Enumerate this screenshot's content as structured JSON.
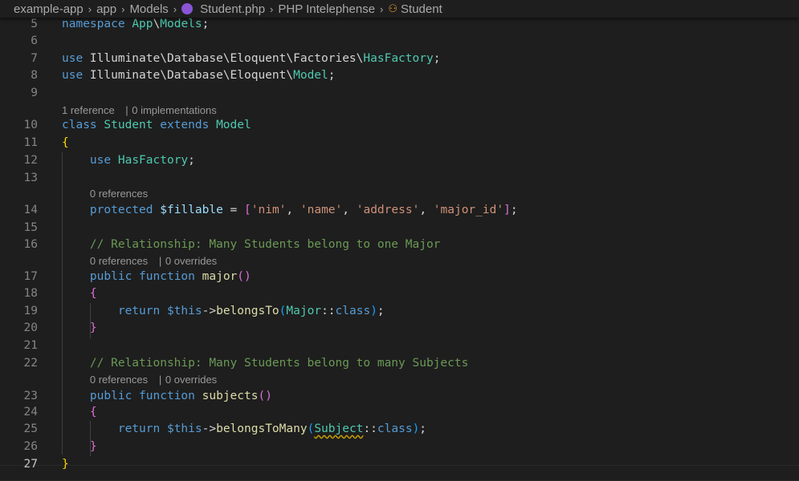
{
  "breadcrumb": {
    "items": [
      "example-app",
      "app",
      "Models",
      "Student.php",
      "PHP Intelephense",
      "Student"
    ],
    "separator": "›",
    "file_icon": "php-elephant-icon",
    "symbol_icon": "class-symbol-icon"
  },
  "colors": {
    "background": "#1e1e1e",
    "keyword": "#569cd6",
    "class_name": "#4ec9b0",
    "function": "#dcdcaa",
    "string": "#ce9178",
    "comment": "#6a9955",
    "variable": "#9cdcfe",
    "bracket_level1": "#ffd700",
    "bracket_level2": "#da70d6",
    "bracket_level3": "#179fff"
  },
  "editor": {
    "active_line": "27",
    "lines": [
      {
        "number": "5",
        "tokens": [
          {
            "t": "namespace",
            "c": "kw"
          },
          {
            "t": " ",
            "c": "txt"
          },
          {
            "t": "App",
            "c": "cls"
          },
          {
            "t": "\\",
            "c": "txt"
          },
          {
            "t": "Models",
            "c": "cls"
          },
          {
            "t": ";",
            "c": "txt"
          }
        ]
      },
      {
        "number": "6",
        "tokens": []
      },
      {
        "number": "7",
        "tokens": [
          {
            "t": "use",
            "c": "kw"
          },
          {
            "t": " Illuminate\\Database\\Eloquent\\Factories\\",
            "c": "txt"
          },
          {
            "t": "HasFactory",
            "c": "cls"
          },
          {
            "t": ";",
            "c": "txt"
          }
        ]
      },
      {
        "number": "8",
        "tokens": [
          {
            "t": "use",
            "c": "kw"
          },
          {
            "t": " Illuminate\\Database\\Eloquent\\",
            "c": "txt"
          },
          {
            "t": "Model",
            "c": "cls"
          },
          {
            "t": ";",
            "c": "txt"
          }
        ]
      },
      {
        "number": "9",
        "tokens": []
      },
      {
        "lens": [
          "1 reference",
          "0 implementations"
        ]
      },
      {
        "number": "10",
        "tokens": [
          {
            "t": "class",
            "c": "kw"
          },
          {
            "t": " ",
            "c": "txt"
          },
          {
            "t": "Student",
            "c": "cls"
          },
          {
            "t": " ",
            "c": "txt"
          },
          {
            "t": "extends",
            "c": "kw"
          },
          {
            "t": " ",
            "c": "txt"
          },
          {
            "t": "Model",
            "c": "cls"
          }
        ]
      },
      {
        "number": "11",
        "tokens": [
          {
            "t": "{",
            "c": "b1"
          }
        ]
      },
      {
        "number": "12",
        "tokens": [
          {
            "t": "    ",
            "c": "txt"
          },
          {
            "t": "use",
            "c": "kw"
          },
          {
            "t": " ",
            "c": "txt"
          },
          {
            "t": "HasFactory",
            "c": "cls"
          },
          {
            "t": ";",
            "c": "txt"
          }
        ]
      },
      {
        "number": "13",
        "tokens": []
      },
      {
        "lens": [
          "0 references"
        ]
      },
      {
        "number": "14",
        "tokens": [
          {
            "t": "    ",
            "c": "txt"
          },
          {
            "t": "protected",
            "c": "kw"
          },
          {
            "t": " ",
            "c": "txt"
          },
          {
            "t": "$fillable",
            "c": "var"
          },
          {
            "t": " = ",
            "c": "txt"
          },
          {
            "t": "[",
            "c": "b2"
          },
          {
            "t": "'nim'",
            "c": "str"
          },
          {
            "t": ", ",
            "c": "txt"
          },
          {
            "t": "'name'",
            "c": "str"
          },
          {
            "t": ", ",
            "c": "txt"
          },
          {
            "t": "'address'",
            "c": "str"
          },
          {
            "t": ", ",
            "c": "txt"
          },
          {
            "t": "'major_id'",
            "c": "str"
          },
          {
            "t": "]",
            "c": "b2"
          },
          {
            "t": ";",
            "c": "txt"
          }
        ]
      },
      {
        "number": "15",
        "tokens": []
      },
      {
        "number": "16",
        "tokens": [
          {
            "t": "    ",
            "c": "txt"
          },
          {
            "t": "// Relationship: Many Students belong to one Major",
            "c": "cmt"
          }
        ]
      },
      {
        "lens": [
          "0 references",
          "0 overrides"
        ]
      },
      {
        "number": "17",
        "tokens": [
          {
            "t": "    ",
            "c": "txt"
          },
          {
            "t": "public",
            "c": "kw"
          },
          {
            "t": " ",
            "c": "txt"
          },
          {
            "t": "function",
            "c": "kw"
          },
          {
            "t": " ",
            "c": "txt"
          },
          {
            "t": "major",
            "c": "fn"
          },
          {
            "t": "()",
            "c": "b2"
          }
        ]
      },
      {
        "number": "18",
        "tokens": [
          {
            "t": "    ",
            "c": "txt"
          },
          {
            "t": "{",
            "c": "b2"
          }
        ]
      },
      {
        "number": "19",
        "tokens": [
          {
            "t": "        ",
            "c": "txt"
          },
          {
            "t": "return",
            "c": "kw"
          },
          {
            "t": " ",
            "c": "txt"
          },
          {
            "t": "$this",
            "c": "kw"
          },
          {
            "t": "->",
            "c": "txt"
          },
          {
            "t": "belongsTo",
            "c": "fn"
          },
          {
            "t": "(",
            "c": "b3"
          },
          {
            "t": "Major",
            "c": "cls"
          },
          {
            "t": "::",
            "c": "txt"
          },
          {
            "t": "class",
            "c": "kw"
          },
          {
            "t": ")",
            "c": "b3"
          },
          {
            "t": ";",
            "c": "txt"
          }
        ]
      },
      {
        "number": "20",
        "tokens": [
          {
            "t": "    ",
            "c": "txt"
          },
          {
            "t": "}",
            "c": "b2"
          }
        ]
      },
      {
        "number": "21",
        "tokens": []
      },
      {
        "number": "22",
        "tokens": [
          {
            "t": "    ",
            "c": "txt"
          },
          {
            "t": "// Relationship: Many Students belong to many Subjects",
            "c": "cmt"
          }
        ]
      },
      {
        "lens": [
          "0 references",
          "0 overrides"
        ]
      },
      {
        "number": "23",
        "tokens": [
          {
            "t": "    ",
            "c": "txt"
          },
          {
            "t": "public",
            "c": "kw"
          },
          {
            "t": " ",
            "c": "txt"
          },
          {
            "t": "function",
            "c": "kw"
          },
          {
            "t": " ",
            "c": "txt"
          },
          {
            "t": "subjects",
            "c": "fn"
          },
          {
            "t": "()",
            "c": "b2"
          }
        ]
      },
      {
        "number": "24",
        "tokens": [
          {
            "t": "    ",
            "c": "txt"
          },
          {
            "t": "{",
            "c": "b2"
          }
        ]
      },
      {
        "number": "25",
        "tokens": [
          {
            "t": "        ",
            "c": "txt"
          },
          {
            "t": "return",
            "c": "kw"
          },
          {
            "t": " ",
            "c": "txt"
          },
          {
            "t": "$this",
            "c": "kw"
          },
          {
            "t": "->",
            "c": "txt"
          },
          {
            "t": "belongsToMany",
            "c": "fn"
          },
          {
            "t": "(",
            "c": "b3"
          },
          {
            "t": "Subject",
            "c": "cls squig"
          },
          {
            "t": "::",
            "c": "txt"
          },
          {
            "t": "class",
            "c": "kw"
          },
          {
            "t": ")",
            "c": "b3"
          },
          {
            "t": ";",
            "c": "txt"
          }
        ]
      },
      {
        "number": "26",
        "tokens": [
          {
            "t": "    ",
            "c": "txt"
          },
          {
            "t": "}",
            "c": "b2"
          }
        ]
      },
      {
        "number": "27",
        "tokens": [
          {
            "t": "}",
            "c": "b1"
          }
        ]
      }
    ]
  }
}
